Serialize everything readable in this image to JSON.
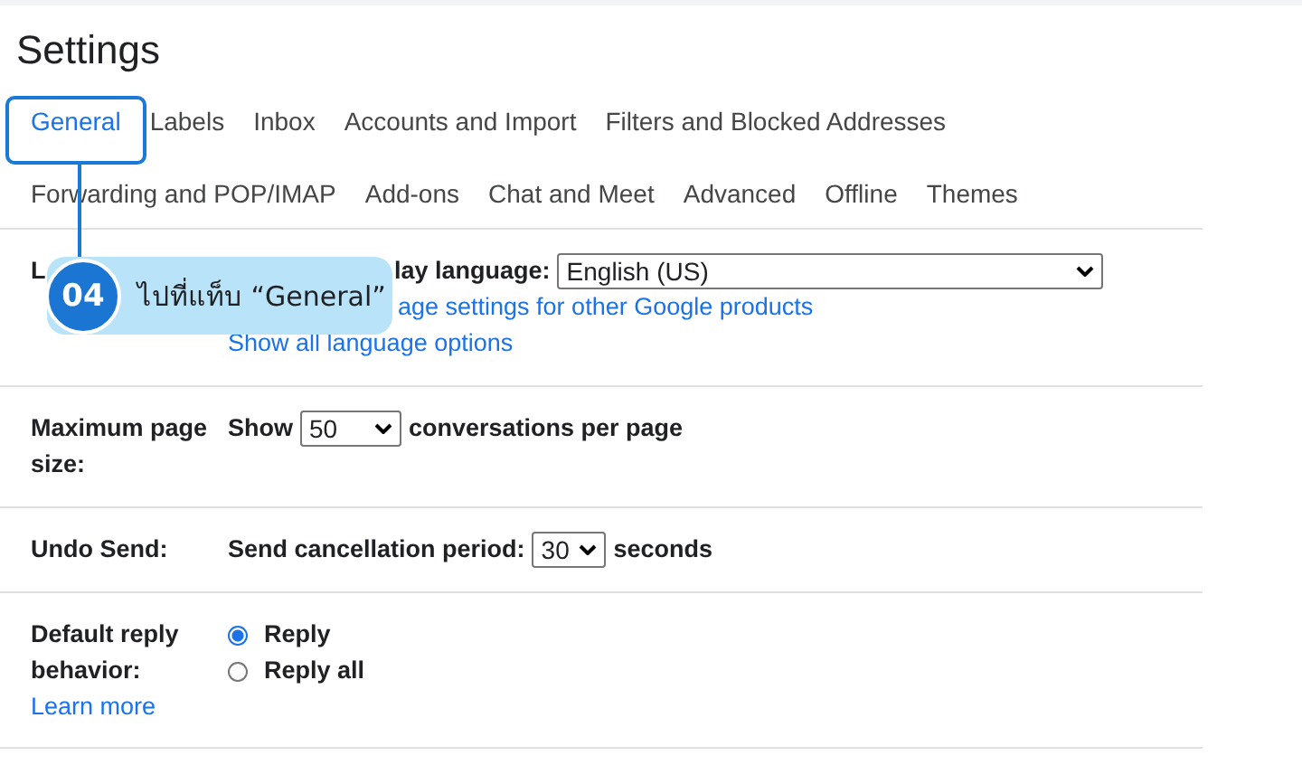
{
  "title": "Settings",
  "tabs": [
    {
      "label": "General",
      "selected": true
    },
    {
      "label": "Labels",
      "selected": false
    },
    {
      "label": "Inbox",
      "selected": false
    },
    {
      "label": "Accounts and Import",
      "selected": false
    },
    {
      "label": "Filters and Blocked Addresses",
      "selected": false
    },
    {
      "label": "Forwarding and POP/IMAP",
      "selected": false
    },
    {
      "label": "Add-ons",
      "selected": false
    },
    {
      "label": "Chat and Meet",
      "selected": false
    },
    {
      "label": "Advanced",
      "selected": false
    },
    {
      "label": "Offline",
      "selected": false
    },
    {
      "label": "Themes",
      "selected": false
    }
  ],
  "language": {
    "label": "L",
    "text": "lay language:",
    "value": "English (US)",
    "link": "age settings for other Google products",
    "link_2": "Show all language options"
  },
  "page_size": {
    "label": "Maximum page size:",
    "before": "Show",
    "value": "50",
    "after": "conversations per page"
  },
  "undo_send": {
    "label": "Undo Send:",
    "before": "Send cancellation period:",
    "value": "30",
    "after": "seconds"
  },
  "reply": {
    "label": "Default reply behavior:",
    "link": "Learn more",
    "options": [
      {
        "label": "Reply",
        "selected": true
      },
      {
        "label": "Reply all",
        "selected": false
      }
    ]
  },
  "callout": {
    "number": "04",
    "text": "ไปที่แท็บ “General”"
  }
}
